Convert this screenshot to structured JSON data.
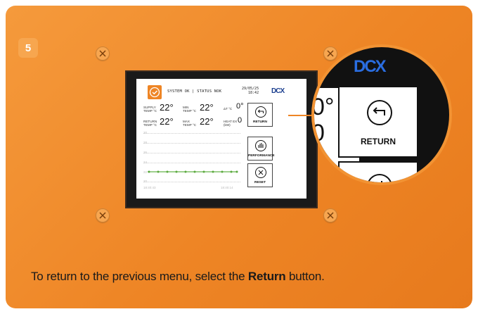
{
  "step": {
    "number": "5"
  },
  "device_screen": {
    "status_text": "SYSTEM OK | STATUS NOK",
    "date": "29/05/25",
    "time": "18:42",
    "logo": "DCX",
    "rows": [
      {
        "label1": "SUPPLY TEMP °C",
        "value1": "22°",
        "label2": "MIN TEMP °C",
        "value2": "22°",
        "label3": "ΔT °C",
        "value3": "0°"
      },
      {
        "label1": "RETURN TEMP °C",
        "value1": "22°",
        "label2": "MAX TEMP °C",
        "value2": "22°",
        "label3": "HEAT EX (kW)",
        "value3": "0"
      }
    ],
    "buttons": [
      {
        "label": "RETURN",
        "icon": "return-arrow-icon"
      },
      {
        "label": "PERFORMANCE",
        "icon": "bar-chart-icon"
      },
      {
        "label": "RESET",
        "icon": "x-circle-icon"
      }
    ],
    "graph_ticks": [
      "30",
      "28",
      "26",
      "24",
      "22",
      "20"
    ],
    "graph_time_start": "18:40:43",
    "graph_time_end": "18:40:14"
  },
  "zoom": {
    "logo": "DCX",
    "digit1": "0°",
    "digit2": "0",
    "button_label": "RETURN"
  },
  "caption": {
    "before": "To return to the previous menu, select the ",
    "bold": "Return",
    "after": " button."
  },
  "colors": {
    "accent": "#ee8525",
    "brand_blue": "#2a6de0"
  }
}
